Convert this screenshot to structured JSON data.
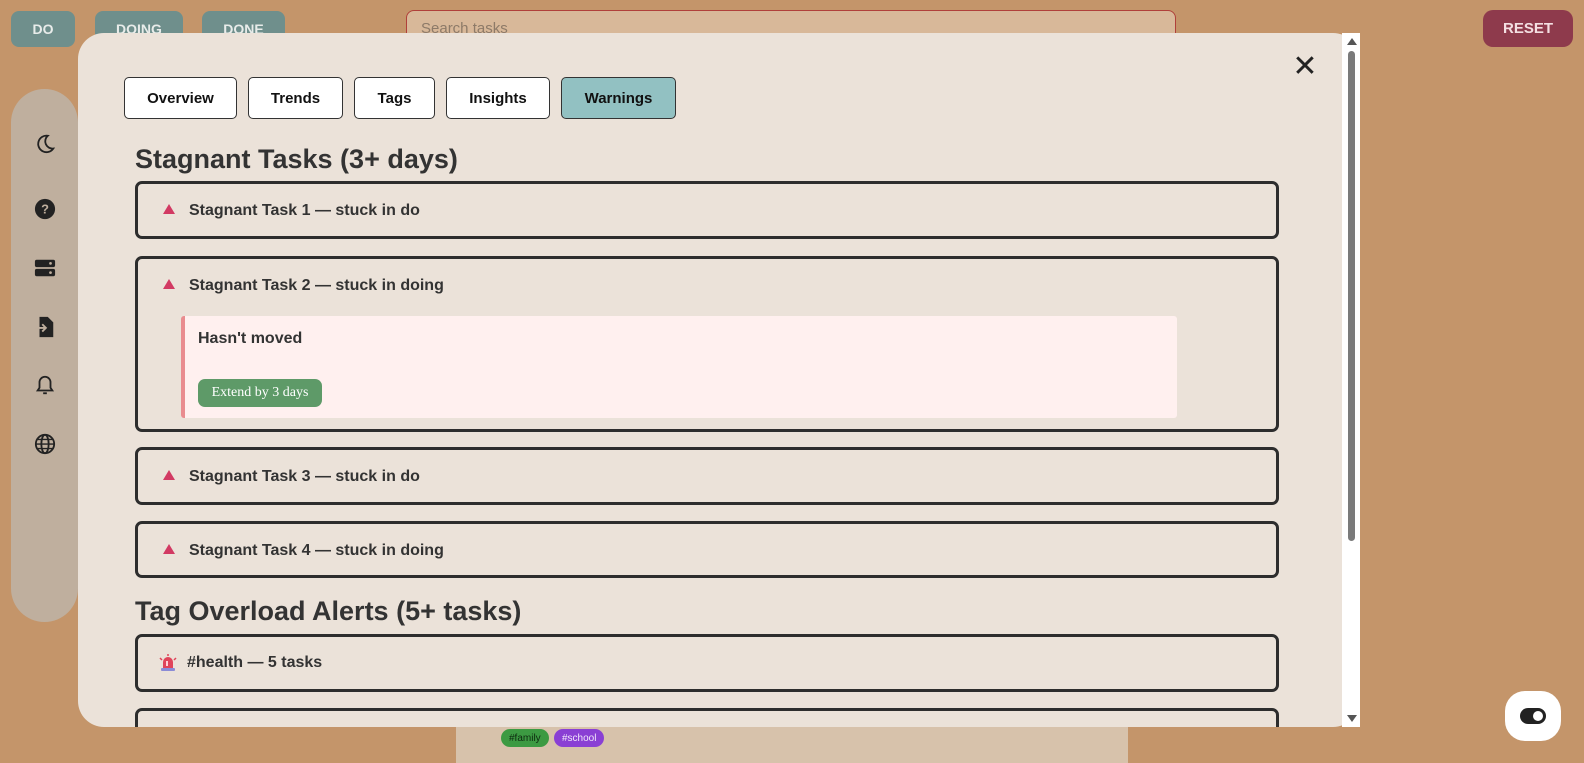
{
  "header": {
    "columns": [
      "DO",
      "DOING",
      "DONE"
    ],
    "search_placeholder": "Search tasks",
    "reset_label": "RESET"
  },
  "sidebar": {
    "icons": [
      "moon-icon",
      "help-icon",
      "storage-icon",
      "import-icon",
      "bell-icon",
      "globe-icon"
    ]
  },
  "background": {
    "tags": [
      "#family",
      "#school"
    ]
  },
  "modal": {
    "tabs": [
      {
        "label": "Overview",
        "active": false
      },
      {
        "label": "Trends",
        "active": false
      },
      {
        "label": "Tags",
        "active": false
      },
      {
        "label": "Insights",
        "active": false
      },
      {
        "label": "Warnings",
        "active": true
      }
    ],
    "close_label": "✕",
    "stagnant": {
      "title": "Stagnant Tasks (3+ days)",
      "tasks": [
        {
          "label": "Stagnant Task 1 — stuck in do"
        },
        {
          "label": "Stagnant Task 2 — stuck in doing",
          "detail": "Hasn't moved",
          "action": "Extend by 3 days"
        },
        {
          "label": "Stagnant Task 3 — stuck in do"
        },
        {
          "label": "Stagnant Task 4 — stuck in doing"
        }
      ]
    },
    "overload": {
      "title": "Tag Overload Alerts (5+ tasks)",
      "alerts": [
        {
          "label": "#health — 5 tasks"
        }
      ]
    }
  },
  "colors": {
    "background": "#c4956a",
    "modal": "#ebe2d9",
    "active_tab": "#92c1c2",
    "warning_triangle": "#d23a63",
    "extend_button": "#5e9a68",
    "reset_button": "#8e3a4c"
  }
}
